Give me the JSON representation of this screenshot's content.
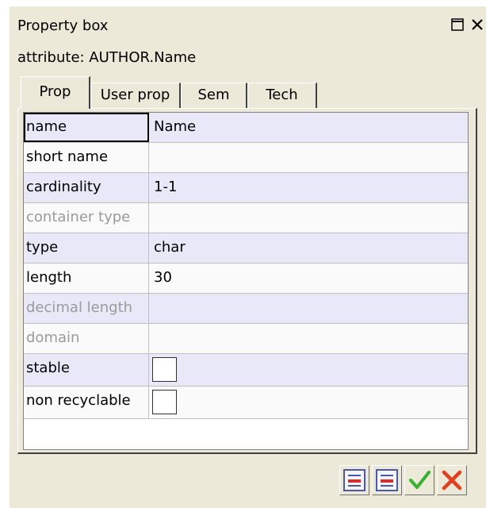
{
  "window": {
    "title": "Property box",
    "subtitle": "attribute: AUTHOR.Name"
  },
  "tabs": [
    "Prop",
    "User prop",
    "Sem",
    "Tech"
  ],
  "active_tab": "Prop",
  "properties": [
    {
      "label": "name",
      "value": "Name",
      "enabled": true
    },
    {
      "label": "short name",
      "value": "",
      "enabled": true
    },
    {
      "label": "cardinality",
      "value": "1-1",
      "enabled": true
    },
    {
      "label": "container type",
      "value": "",
      "enabled": false
    },
    {
      "label": "type",
      "value": "char",
      "enabled": true
    },
    {
      "label": "length",
      "value": "30",
      "enabled": true
    },
    {
      "label": "decimal length",
      "value": "",
      "enabled": false
    },
    {
      "label": "domain",
      "value": "",
      "enabled": false
    },
    {
      "label": "stable",
      "checked": false,
      "enabled": true
    },
    {
      "label": "non recyclable",
      "checked": false,
      "enabled": true
    }
  ],
  "icons": {
    "restore": "restore-window-icon",
    "close": "close-icon",
    "remove_row_1": "remove-row-icon",
    "remove_row_2": "remove-row-icon",
    "ok": "checkmark-icon",
    "cancel": "cancel-x-icon"
  },
  "colors": {
    "row_alt": "#e8e8f8",
    "ok_green": "#38b030",
    "cancel_red": "#e04020",
    "remove_red": "#d03030"
  }
}
